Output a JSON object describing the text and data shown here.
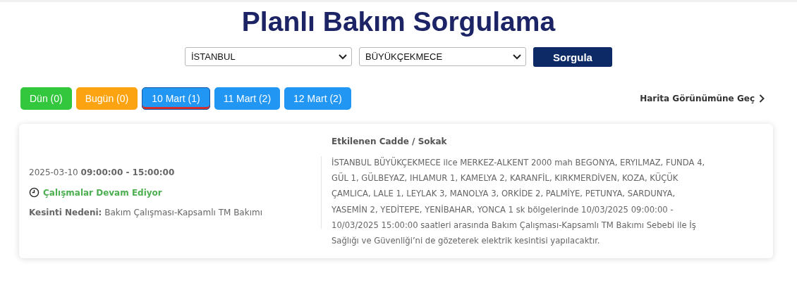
{
  "title": "Planlı Bakım Sorgulama",
  "filters": {
    "province": "İSTANBUL",
    "district": "BÜYÜKÇEKMECE",
    "submit": "Sorgula"
  },
  "date_tabs": [
    {
      "label": "Dün (0)",
      "selected": false,
      "color": "#32c73c"
    },
    {
      "label": "Bugün (0)",
      "selected": false,
      "color": "#fca311"
    },
    {
      "label": "10 Mart (1)",
      "selected": true,
      "color": "#2196f3"
    },
    {
      "label": "11 Mart (2)",
      "selected": false,
      "color": "#2196f3"
    },
    {
      "label": "12 Mart (2)",
      "selected": false,
      "color": "#2196f3"
    }
  ],
  "map_link": "Harita Görünümüne Geç",
  "outages": [
    {
      "date": "2025-03-10",
      "time": "09:00:00 - 15:00:00",
      "status": "Çalışmalar Devam Ediyor",
      "reason_label": "Kesinti Nedeni:",
      "reason": "Bakım Çalışması-Kapsamlı TM Bakımı",
      "streets_heading": "Etkilenen Cadde / Sokak",
      "streets": "İSTANBUL BÜYÜKÇEKMECE ilce MERKEZ-ALKENT 2000 mah BEGONYA, ERYILMAZ, FUNDA 4, GÜL 1, GÜLBEYAZ, IHLAMUR 1, KAMELYA 2, KARANFİL, KIRKMERDİVEN, KOZA, KÜÇÜK ÇAMLICA, LALE 1, LEYLAK 3, MANOLYA 3, ORKİDE 2, PALMİYE, PETUNYA, SARDUNYA, YASEMİN 2, YEDİTEPE, YENİBAHAR, YONCA 1 sk bölgelerinde 10/03/2025 09:00:00 - 10/03/2025 15:00:00 saatleri arasında Bakım Çalışması-Kapsamlı TM Bakımı Sebebi ile İş Sağlığı ve Güvenliği’ni de gözeterek elektrik kesintisi yapılacaktır."
    }
  ]
}
